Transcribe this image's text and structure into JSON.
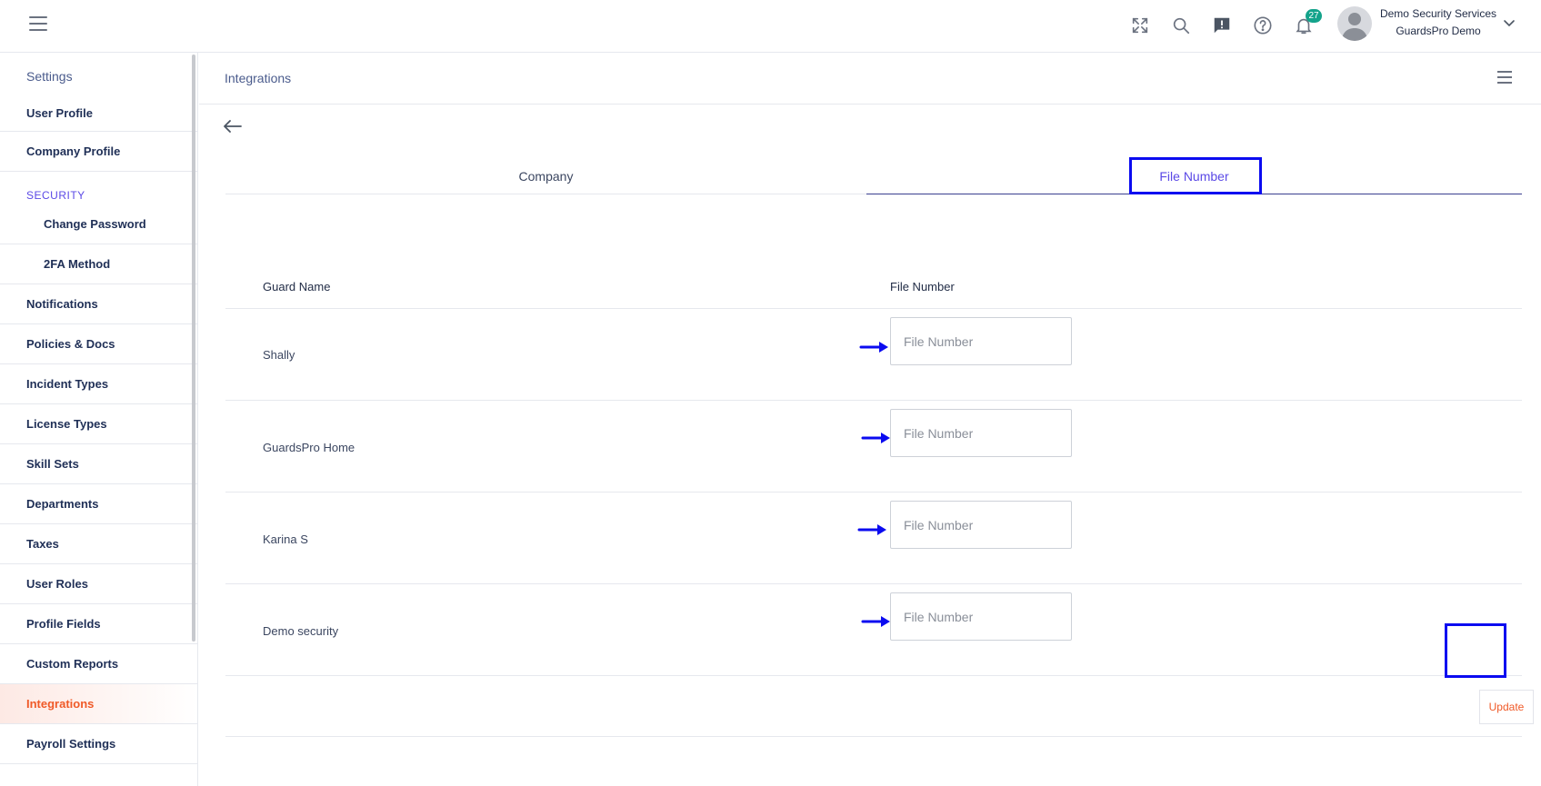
{
  "topbar": {
    "notification_count": "27",
    "user_company": "Demo Security Services",
    "user_sub": "GuardsPro Demo",
    "icons": [
      "hamburger-menu-icon",
      "fullscreen-icon",
      "search-icon",
      "feedback-icon",
      "help-icon",
      "bell-icon",
      "avatar",
      "chevron-down-icon"
    ]
  },
  "sidebar": {
    "title": "Settings",
    "items": {
      "user_profile": "User Profile",
      "company_profile": "Company Profile",
      "security": "SECURITY",
      "change_password": "Change Password",
      "twofa": "2FA Method",
      "notifications": "Notifications",
      "policies": "Policies & Docs",
      "incident_types": "Incident Types",
      "license_types": "License Types",
      "skill_sets": "Skill Sets",
      "departments": "Departments",
      "taxes": "Taxes",
      "user_roles": "User Roles",
      "profile_fields": "Profile Fields",
      "custom_reports": "Custom Reports",
      "integrations": "Integrations",
      "payroll_settings": "Payroll Settings"
    },
    "active": "Integrations"
  },
  "page": {
    "title": "Integrations",
    "tabs": {
      "company": "Company",
      "file_number": "File Number"
    },
    "active_tab": "File Number",
    "columns": {
      "guard_name": "Guard Name",
      "file_number": "File Number"
    },
    "rows": [
      {
        "name": "Shally",
        "value": "",
        "placeholder": "File Number"
      },
      {
        "name": "GuardsPro Home",
        "value": "",
        "placeholder": "File Number"
      },
      {
        "name": "Karina S",
        "value": "",
        "placeholder": "File Number"
      },
      {
        "name": "Demo security",
        "value": "",
        "placeholder": "File Number"
      }
    ],
    "update_label": "Update"
  },
  "colors": {
    "accent": "#5b49e6",
    "active_nav": "#f05a28",
    "annotation": "#0b0bf0",
    "badge": "#14a38b"
  }
}
